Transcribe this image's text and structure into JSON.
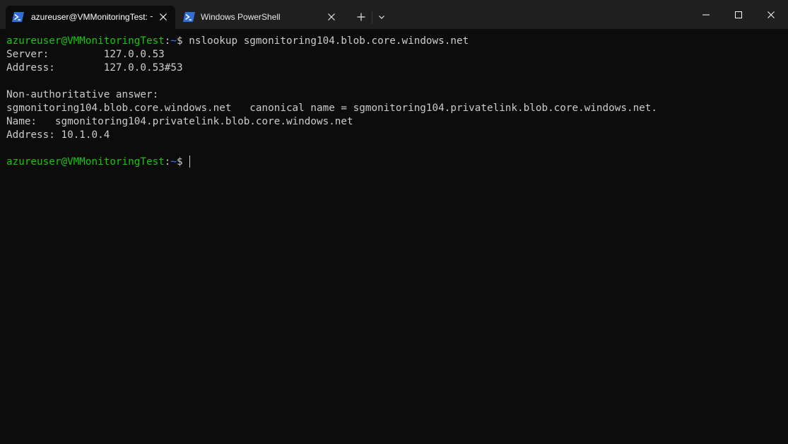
{
  "tabs": [
    {
      "title": "azureuser@VMMonitoringTest: ~",
      "icon": "powershell-icon",
      "active": true
    },
    {
      "title": "Windows PowerShell",
      "icon": "powershell-icon",
      "active": false
    }
  ],
  "titlebar": {
    "new_tab_glyph": "+",
    "dropdown_icon": "chevron-down-icon",
    "window_controls": [
      "minimize-icon",
      "maximize-icon",
      "close-icon"
    ]
  },
  "colors": {
    "background": "#0c0c0c",
    "titlebar": "#1f1f1f",
    "prompt_user": "#16c60c",
    "prompt_path": "#3b78ff",
    "text": "#cccccc"
  },
  "terminal": {
    "prompt_user": "azureuser@VMMonitoringTest",
    "prompt_sep": ":",
    "prompt_path": "~",
    "prompt_symbol": "$",
    "command": " nslookup sgmonitoring104.blob.core.windows.net",
    "output": [
      "Server:         127.0.0.53",
      "Address:        127.0.0.53#53",
      "",
      "Non-authoritative answer:",
      "sgmonitoring104.blob.core.windows.net   canonical name = sgmonitoring104.privatelink.blob.core.windows.net.",
      "Name:   sgmonitoring104.privatelink.blob.core.windows.net",
      "Address: 10.1.0.4",
      ""
    ],
    "final_prompt_symbol": "$"
  }
}
